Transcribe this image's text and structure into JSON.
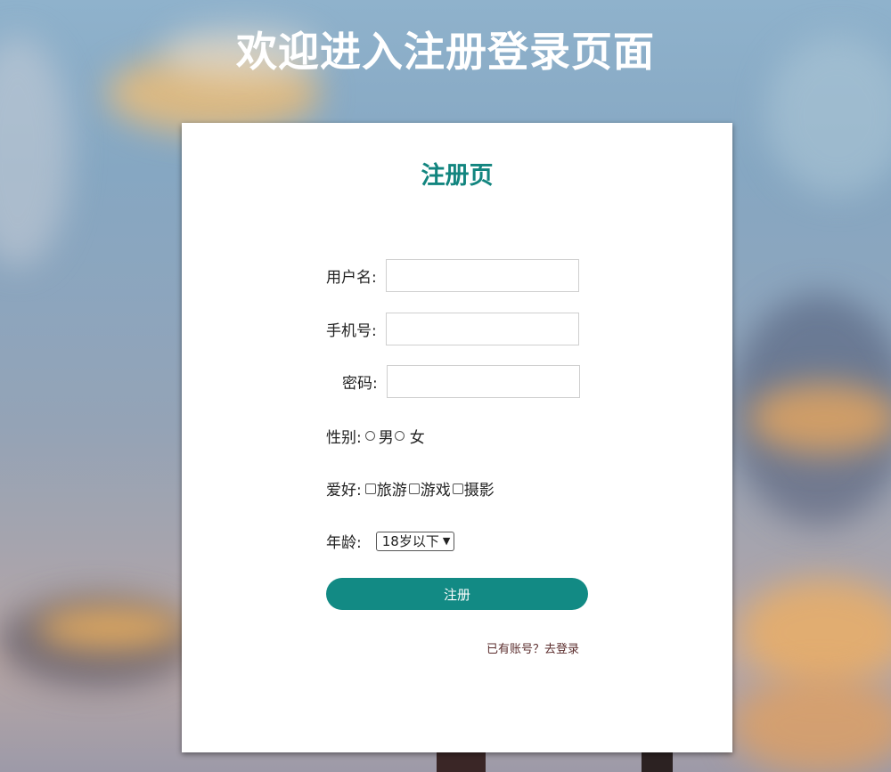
{
  "page": {
    "title": "欢迎进入注册登录页面"
  },
  "form": {
    "title": "注册页",
    "username_label": "用户名:",
    "phone_label": "手机号:",
    "password_label": "密码:",
    "gender": {
      "label": "性别:",
      "options": [
        "男",
        "女"
      ]
    },
    "hobbies": {
      "label": "爱好:",
      "options": [
        "旅游",
        "游戏",
        "摄影"
      ]
    },
    "age": {
      "label": "年龄:",
      "selected": "18岁以下"
    },
    "submit_label": "注册",
    "login_link": "已有账号？去登录"
  },
  "colors": {
    "accent": "#128a84",
    "card_bg": "#ffffff",
    "link": "#5b2d2d"
  }
}
